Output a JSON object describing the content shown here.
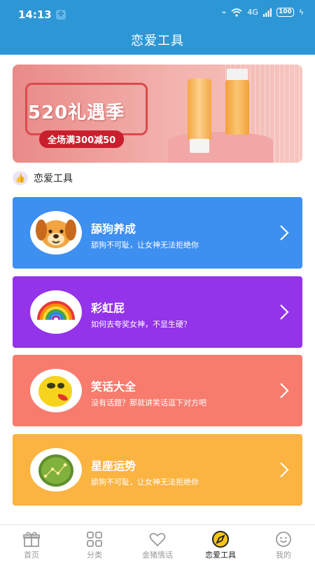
{
  "status_bar": {
    "time": "14:13",
    "network": "4G",
    "battery": "100"
  },
  "header": {
    "title": "恋爱工具"
  },
  "banner": {
    "title": "520礼遇季",
    "promo": "全场满300减50"
  },
  "section": {
    "title": "恋爱工具"
  },
  "cards": [
    {
      "title": "舔狗养成",
      "desc": "舔狗不可耻，让女神无法拒绝你",
      "color": "#3d8ff0",
      "icon": "dog-face-icon"
    },
    {
      "title": "彩虹屁",
      "desc": "如何去夸奖女神，不显生硬？",
      "color": "#9333ea",
      "icon": "rainbow-icon"
    },
    {
      "title": "笑话大全",
      "desc": "没有话题？那就讲笑话逗下对方吧",
      "color": "#f77c6e",
      "icon": "laughing-face-icon"
    },
    {
      "title": "星座运势",
      "desc": "舔狗不可耻，让女神无法拒绝你",
      "color": "#fbb341",
      "icon": "constellation-icon"
    }
  ],
  "tabbar": {
    "active": "恋爱工具",
    "items": [
      {
        "label": "首页",
        "icon": "gift-icon"
      },
      {
        "label": "分类",
        "icon": "grid-icon"
      },
      {
        "label": "金猪情话",
        "icon": "heart-icon"
      },
      {
        "label": "恋爱工具",
        "icon": "compass-icon"
      },
      {
        "label": "我的",
        "icon": "smiley-icon"
      }
    ]
  }
}
